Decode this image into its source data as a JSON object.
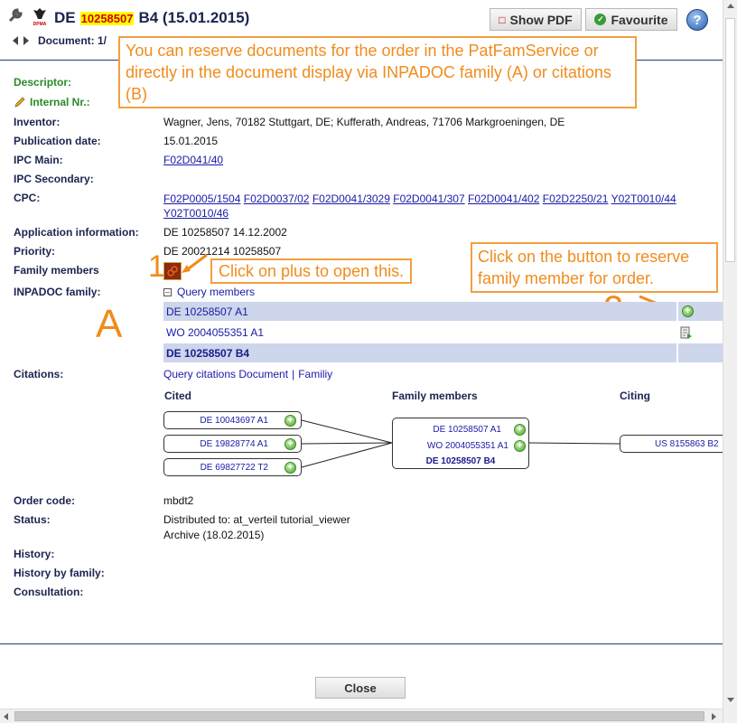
{
  "header": {
    "title_prefix": "DE",
    "title_number": "10258507",
    "title_suffix": "B4 (15.01.2015)",
    "doc_nav_label": "Document: 1/",
    "show_pdf": "Show PDF",
    "favourite": "Favourite",
    "help": "?",
    "logo_text": "DPMA"
  },
  "callouts": {
    "top": "You can reserve documents for the order in the PatFamService or directly in the document display via INPADOC family (A) or citations (B)",
    "plus_hint": "Click on plus to open this.",
    "reserve_hint": "Click on the button to reserve family member for order.",
    "marker_1": "1",
    "marker_2": "2",
    "marker_a": "A"
  },
  "fields": {
    "descriptor_label": "Descriptor:",
    "internal_label": "Internal Nr.:",
    "inventor_label": "Inventor:",
    "inventor_value": "Wagner, Jens, 70182 Stuttgart, DE; Kufferath, Andreas, 71706 Markgroeningen, DE",
    "pubdate_label": "Publication date:",
    "pubdate_value": "15.01.2015",
    "ipc_main_label": "IPC Main:",
    "ipc_main_value": "F02D041/40",
    "ipc_secondary_label": "IPC Secondary:",
    "cpc_label": "CPC:",
    "cpc_values": [
      "F02P0005/1504",
      "F02D0037/02",
      "F02D0041/3029",
      "F02D0041/307",
      "F02D0041/402",
      "F02D2250/21",
      "Y02T0010/44",
      "Y02T0010/46"
    ],
    "appinfo_label": "Application information:",
    "appinfo_value": "DE 10258507 14.12.2002",
    "priority_label": "Priority:",
    "priority_value": "DE 20021214 10258507",
    "family_label": "Family members",
    "inpadoc_label": "INPADOC family:",
    "query_members": "Query members",
    "inpadoc_rows": [
      "DE 10258507 A1",
      "WO 2004055351 A1",
      "DE 10258507 B4"
    ],
    "citations_label": "Citations:",
    "query_citations": "Query citations Document",
    "familiy": "Familiy",
    "separator": "|",
    "order_label": "Order code:",
    "order_value": "mbdt2",
    "status_label": "Status:",
    "status_line1": "Distributed to: at_verteil tutorial_viewer",
    "status_line2": "Archive (18.02.2015)",
    "history_label": "History:",
    "history_family_label": "History by family:",
    "consultation_label": "Consultation:"
  },
  "graph": {
    "cited_label": "Cited",
    "family_label": "Family members",
    "citing_label": "Citing",
    "cited": [
      "DE 10043697 A1",
      "DE 19828774 A1",
      "DE 69827722 T2"
    ],
    "family": [
      "DE 10258507 A1",
      "WO 2004055351 A1",
      "DE 10258507 B4"
    ],
    "citing": [
      "US 8155863 B2"
    ]
  },
  "footer": {
    "close": "Close"
  },
  "colors": {
    "accent": "#f08c1c",
    "link": "#1a1aa8",
    "row_highlight": "#cdd6ea",
    "label": "#1b2450",
    "green": "#2a8a2a"
  }
}
